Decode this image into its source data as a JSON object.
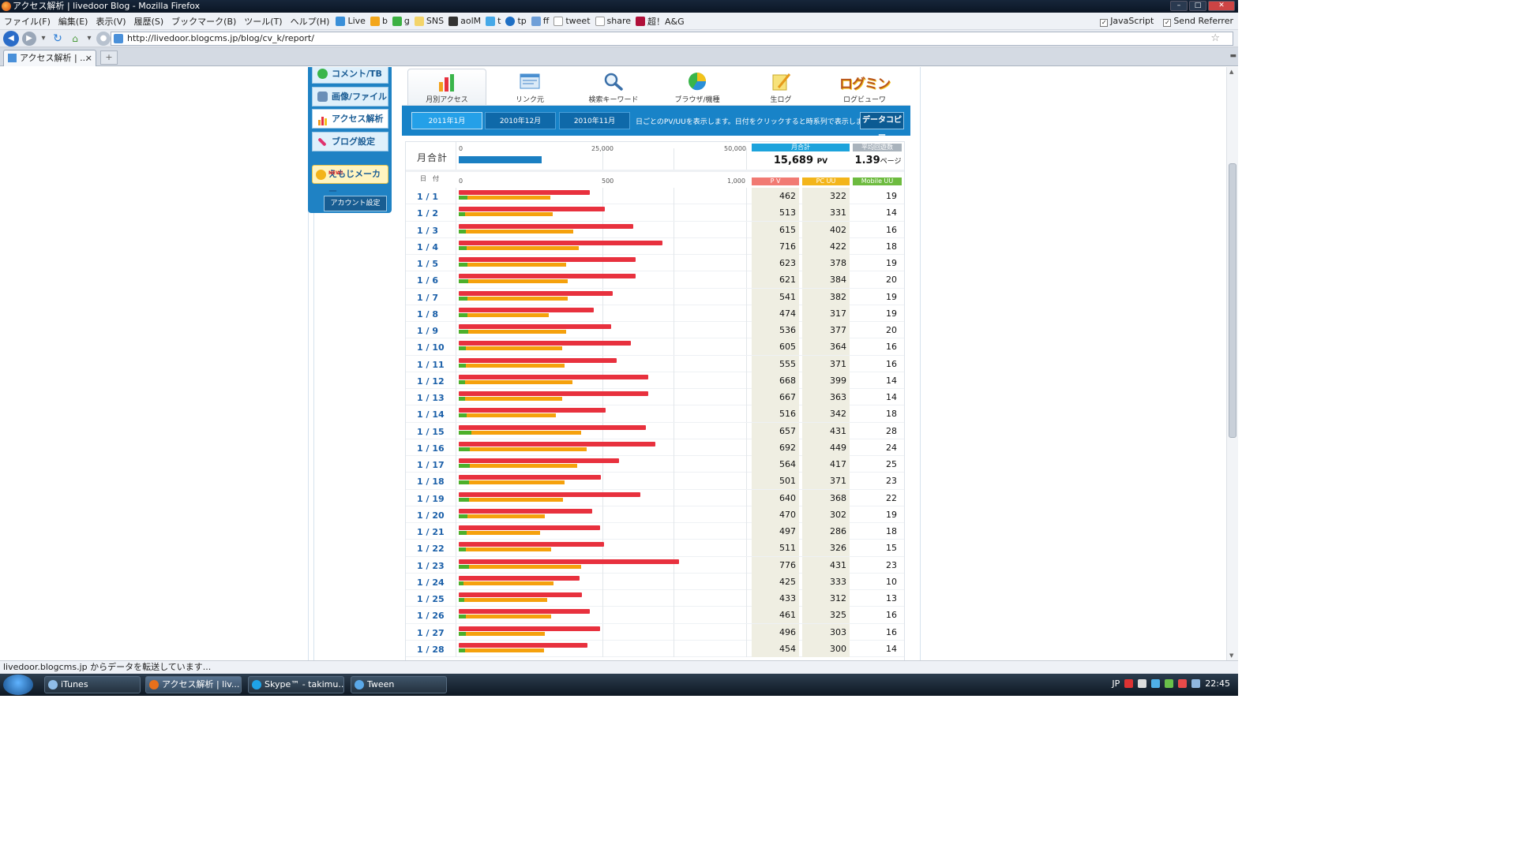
{
  "window": {
    "title": "アクセス解析 | livedoor Blog - Mozilla Firefox"
  },
  "menu": {
    "items": [
      "ファイル(F)",
      "編集(E)",
      "表示(V)",
      "履歴(S)",
      "ブックマーク(B)",
      "ツール(T)",
      "ヘルプ(H)"
    ],
    "bookmarks": [
      "Live",
      "b",
      "g",
      "SNS",
      "aolM",
      "t",
      "tp",
      "ff",
      "tweet",
      "share",
      "超！A&G"
    ],
    "javascript_label": "JavaScript",
    "send_referrer_label": "Send Referrer"
  },
  "nav": {
    "url": "http://livedoor.blogcms.jp/blog/cv_k/report/"
  },
  "tabs": {
    "active_label": "アクセス解析 | ...",
    "close": "×",
    "new_tab": "+"
  },
  "sidebar": {
    "items": [
      {
        "label": "コメント/TB"
      },
      {
        "label": "画像/ファイル"
      },
      {
        "label": "アクセス解析"
      },
      {
        "label": "ブログ設定"
      }
    ],
    "emoji_new": "NEW!",
    "emoji_label": "えもじメーカー",
    "account_label": "アカウント設定"
  },
  "report_tabs": [
    {
      "label": "月別アクセス"
    },
    {
      "label": "リンク元"
    },
    {
      "label": "検索キーワード"
    },
    {
      "label": "ブラウザ/機種"
    },
    {
      "label": "生ログ"
    },
    {
      "label": "ログビューワ"
    }
  ],
  "logo_text": "ログミン",
  "month_buttons": [
    "2011年1月",
    "2010年12月",
    "2010年11月"
  ],
  "month_note": "日ごとのPV/UUを表示します。日付をクリックすると時系列で表示します。",
  "data_copy_label": "データコピー",
  "summary": {
    "label": "月合計",
    "axis": [
      "0",
      "25,000",
      "50,000"
    ],
    "header_total": "月合計",
    "header_avg": "平均回遊数",
    "pv_value": "15,689",
    "pv_unit": "PV",
    "avg_value": "1.39",
    "avg_unit": "ページ"
  },
  "table": {
    "date_header": "日　付",
    "axis": [
      "0",
      "500",
      "1,000"
    ],
    "col_pv": "P V",
    "col_pc": "PC UU",
    "col_mb": "Mobile UU"
  },
  "chart_data": {
    "type": "bar",
    "title": "",
    "xlim": [
      0,
      1000
    ],
    "total_pv": 15689,
    "total_axis": [
      0,
      50000
    ],
    "categories": [
      "1 / 1",
      "1 / 2",
      "1 / 3",
      "1 / 4",
      "1 / 5",
      "1 / 6",
      "1 / 7",
      "1 / 8",
      "1 / 9",
      "1 / 10",
      "1 / 11",
      "1 / 12",
      "1 / 13",
      "1 / 14",
      "1 / 15",
      "1 / 16",
      "1 / 17",
      "1 / 18",
      "1 / 19",
      "1 / 20",
      "1 / 21",
      "1 / 22",
      "1 / 23",
      "1 / 24",
      "1 / 25",
      "1 / 26",
      "1 / 27",
      "1 / 28"
    ],
    "series": [
      {
        "name": "P V",
        "color": "#e8313e",
        "values": [
          462,
          513,
          615,
          716,
          623,
          621,
          541,
          474,
          536,
          605,
          555,
          668,
          667,
          516,
          657,
          692,
          564,
          501,
          640,
          470,
          497,
          511,
          776,
          425,
          433,
          461,
          496,
          454
        ]
      },
      {
        "name": "PC UU",
        "color": "#f5a10d",
        "values": [
          322,
          331,
          402,
          422,
          378,
          384,
          382,
          317,
          377,
          364,
          371,
          399,
          363,
          342,
          431,
          449,
          417,
          371,
          368,
          302,
          286,
          326,
          431,
          333,
          312,
          325,
          303,
          300
        ]
      },
      {
        "name": "Mobile UU",
        "color": "#4caf2a",
        "values": [
          19,
          14,
          16,
          18,
          19,
          20,
          19,
          19,
          20,
          16,
          16,
          14,
          14,
          18,
          28,
          24,
          25,
          23,
          22,
          19,
          18,
          15,
          23,
          10,
          13,
          16,
          16,
          14
        ]
      }
    ]
  },
  "status": {
    "text": "livedoor.blogcms.jp からデータを転送しています..."
  },
  "taskbar": {
    "items": [
      "iTunes",
      "アクセス解析 | liv...",
      "Skype™ - takimu...",
      "Tween"
    ],
    "lang": "JP",
    "time": "22:45"
  },
  "colors": {
    "accent": "#1883c8",
    "pv": "#e8313e",
    "pc": "#f5a10d",
    "mobile": "#4caf2a"
  }
}
